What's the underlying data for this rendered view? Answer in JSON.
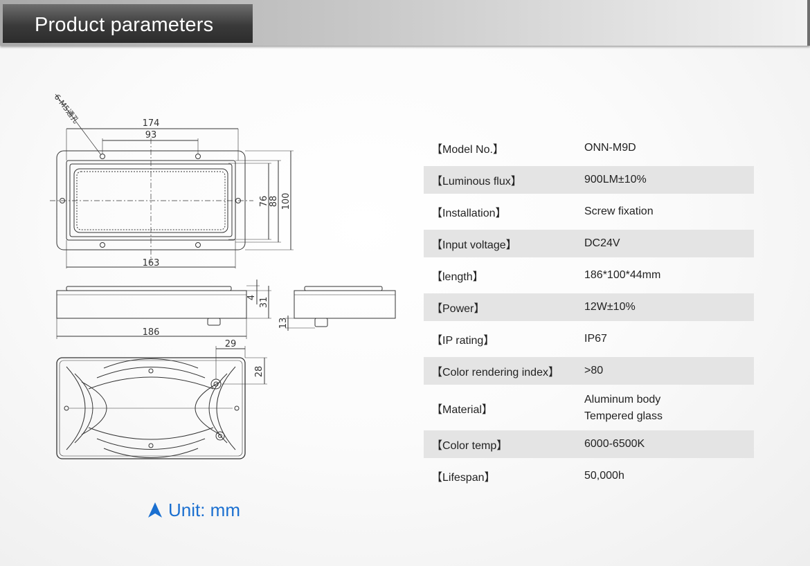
{
  "header": {
    "title": "Product parameters"
  },
  "drawing": {
    "hole_note": "6-M5通孔",
    "dims": {
      "d174": "174",
      "d93": "93",
      "d163": "163",
      "d76": "76",
      "d88": "88",
      "d100": "100",
      "d186": "186",
      "d4": "4",
      "d31": "31",
      "d13": "13",
      "d29": "29",
      "d28": "28"
    }
  },
  "unit": {
    "icon": "up-triangle-icon",
    "label": "Unit: mm",
    "color": "#1a6fd0"
  },
  "specs": [
    {
      "label": "【Model No.】",
      "value": "ONN-M9D"
    },
    {
      "label": "【Luminous flux】",
      "value": "900LM±10%"
    },
    {
      "label": "【Installation】",
      "value": "Screw fixation"
    },
    {
      "label": "【Input voltage】",
      "value": "DC24V"
    },
    {
      "label": "【length】",
      "value": "186*100*44mm"
    },
    {
      "label": "【Power】",
      "value": "12W±10%"
    },
    {
      "label": "【IP rating】",
      "value": "IP67"
    },
    {
      "label": "【Color rendering index】",
      "value": ">80"
    },
    {
      "label": "【Material】",
      "value_lines": [
        "Aluminum body",
        "Tempered glass"
      ]
    },
    {
      "label": "【Color temp】",
      "value": "6000-6500K"
    },
    {
      "label": "【Lifespan】",
      "value": "50,000h"
    }
  ]
}
